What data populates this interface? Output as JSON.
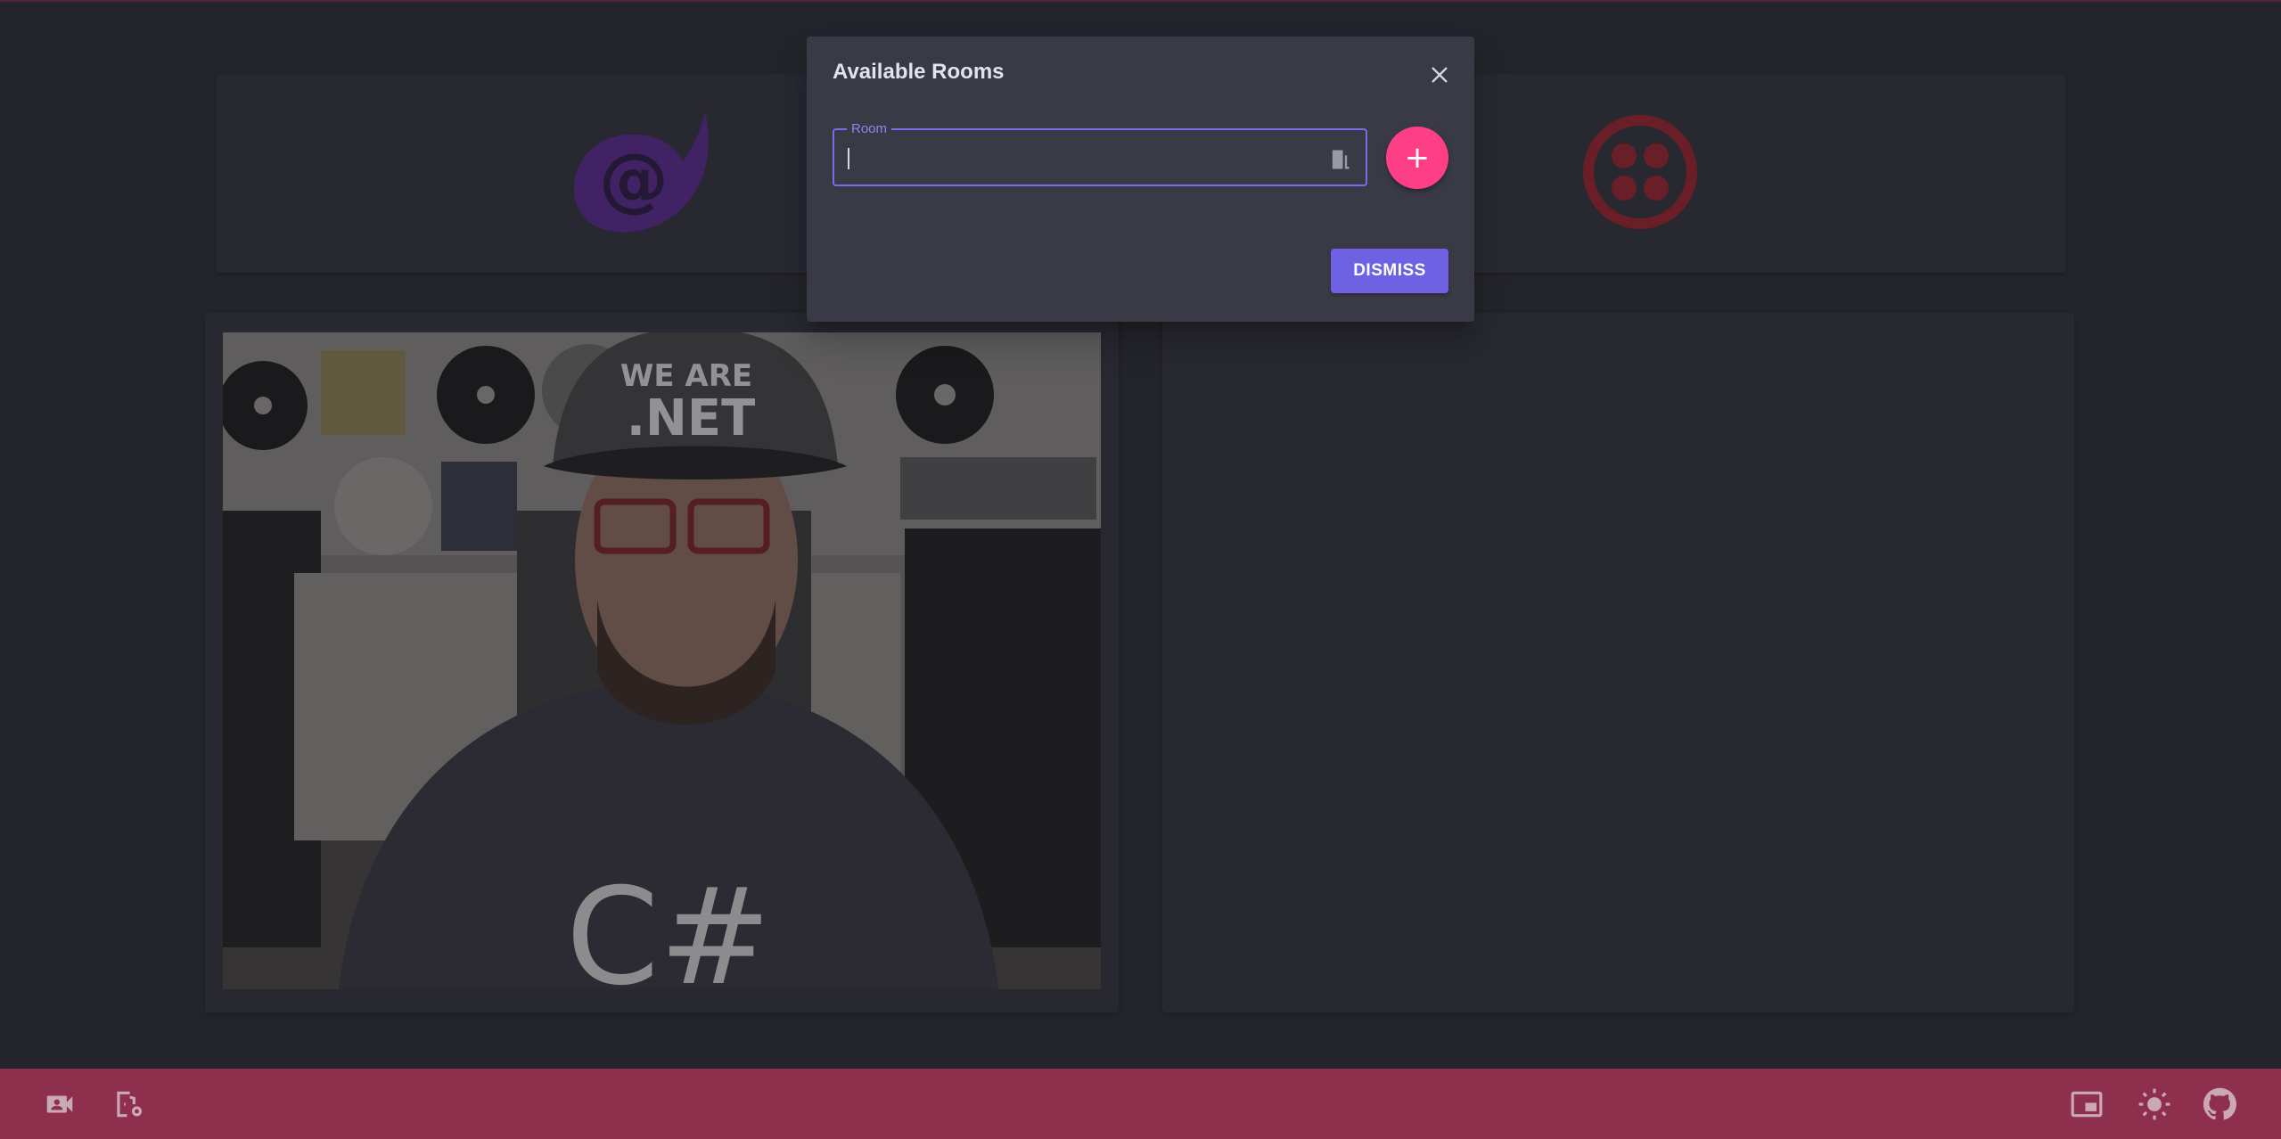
{
  "dialog": {
    "title": "Available Rooms",
    "room_label": "Room",
    "room_value": "",
    "add_button_label": "+",
    "dismiss_label": "DISMISS"
  },
  "header": {
    "left_logo": "blazor-logo",
    "right_logo": "twilio-logo"
  },
  "main": {
    "camera_feed": "local-camera-video",
    "participants": []
  },
  "bottom_bar": {
    "left_icons": [
      "video-camera-icon",
      "room-settings-icon"
    ],
    "right_icons": [
      "picture-in-picture-icon",
      "brightness-icon",
      "github-icon"
    ]
  },
  "colors": {
    "background": "#2e2e37",
    "card": "#34343f",
    "dialog": "#3a3a47",
    "accent_primary": "#6f61e4",
    "accent_pink": "#ff3f85",
    "bottom_bar": "#8f2f4e",
    "blazor_purple": "#5c2d91",
    "twilio_red": "#f22f46"
  }
}
